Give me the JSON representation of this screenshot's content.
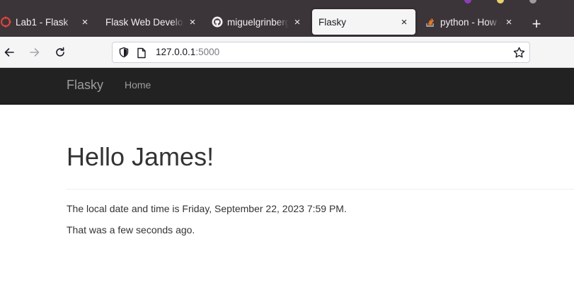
{
  "browser": {
    "tabs": [
      {
        "title": "Lab1 - Flask",
        "favicon": "red-circle-icon",
        "active": false
      },
      {
        "title": "Flask Web Development",
        "favicon": "none",
        "active": false
      },
      {
        "title": "miguelgrinberg/flasky",
        "favicon": "github-icon",
        "active": false
      },
      {
        "title": "Flasky",
        "favicon": "none",
        "active": true
      },
      {
        "title": "python - How do",
        "favicon": "stackoverflow-icon",
        "active": false
      }
    ],
    "new_tab_label": "+",
    "close_glyph": "×",
    "url": {
      "host": "127.0.0.1",
      "port": ":5000"
    }
  },
  "site": {
    "brand": "Flasky",
    "nav": {
      "home": "Home"
    },
    "heading": "Hello James!",
    "paragraph1": "The local date and time is Friday, September 22, 2023 7:59 PM.",
    "paragraph2": "That was a few seconds ago."
  },
  "colors": {
    "chrome_dark": "#3b3439",
    "toolbar": "#f6f5f6",
    "site_navbar": "#222222",
    "site_navbar_text": "#9d9d9d",
    "text": "#333333"
  }
}
